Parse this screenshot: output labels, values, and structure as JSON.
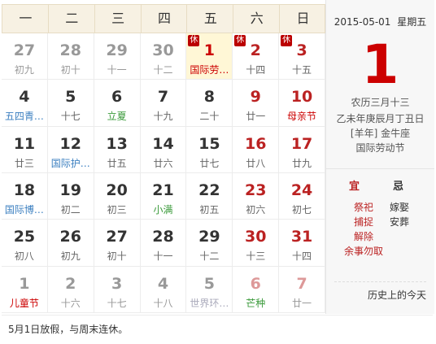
{
  "weekdays": [
    "一",
    "二",
    "三",
    "四",
    "五",
    "六",
    "日"
  ],
  "weeks": [
    [
      {
        "day": "27",
        "lunar": "初九",
        "other": true
      },
      {
        "day": "28",
        "lunar": "初十",
        "other": true
      },
      {
        "day": "29",
        "lunar": "十一",
        "other": true
      },
      {
        "day": "30",
        "lunar": "十二",
        "other": true
      },
      {
        "day": "1",
        "lunar": "国际劳…",
        "badge": "休",
        "selected": true,
        "lunar_style": "festival"
      },
      {
        "day": "2",
        "lunar": "十四",
        "badge": "休",
        "weekend": true
      },
      {
        "day": "3",
        "lunar": "十五",
        "badge": "休",
        "weekend": true
      }
    ],
    [
      {
        "day": "4",
        "lunar": "五四青…",
        "lunar_style": "blue"
      },
      {
        "day": "5",
        "lunar": "十七"
      },
      {
        "day": "6",
        "lunar": "立夏",
        "lunar_style": "green"
      },
      {
        "day": "7",
        "lunar": "十九"
      },
      {
        "day": "8",
        "lunar": "二十"
      },
      {
        "day": "9",
        "lunar": "廿一",
        "weekend": true
      },
      {
        "day": "10",
        "lunar": "母亲节",
        "weekend": true,
        "lunar_style": "red"
      }
    ],
    [
      {
        "day": "11",
        "lunar": "廿三"
      },
      {
        "day": "12",
        "lunar": "国际护…",
        "lunar_style": "blue"
      },
      {
        "day": "13",
        "lunar": "廿五"
      },
      {
        "day": "14",
        "lunar": "廿六"
      },
      {
        "day": "15",
        "lunar": "廿七"
      },
      {
        "day": "16",
        "lunar": "廿八",
        "weekend": true
      },
      {
        "day": "17",
        "lunar": "廿九",
        "weekend": true
      }
    ],
    [
      {
        "day": "18",
        "lunar": "国际博…",
        "lunar_style": "blue"
      },
      {
        "day": "19",
        "lunar": "初二"
      },
      {
        "day": "20",
        "lunar": "初三"
      },
      {
        "day": "21",
        "lunar": "小满",
        "lunar_style": "green"
      },
      {
        "day": "22",
        "lunar": "初五"
      },
      {
        "day": "23",
        "lunar": "初六",
        "weekend": true
      },
      {
        "day": "24",
        "lunar": "初七",
        "weekend": true
      }
    ],
    [
      {
        "day": "25",
        "lunar": "初八"
      },
      {
        "day": "26",
        "lunar": "初九"
      },
      {
        "day": "27",
        "lunar": "初十"
      },
      {
        "day": "28",
        "lunar": "十一"
      },
      {
        "day": "29",
        "lunar": "十二"
      },
      {
        "day": "30",
        "lunar": "十三",
        "weekend": true
      },
      {
        "day": "31",
        "lunar": "十四",
        "weekend": true
      }
    ],
    [
      {
        "day": "1",
        "lunar": "儿童节",
        "other": true,
        "lunar_style": "red"
      },
      {
        "day": "2",
        "lunar": "十六",
        "other": true
      },
      {
        "day": "3",
        "lunar": "十七",
        "other": true
      },
      {
        "day": "4",
        "lunar": "十八",
        "other": true
      },
      {
        "day": "5",
        "lunar": "世界环…",
        "other": true,
        "lunar_style": "gray"
      },
      {
        "day": "6",
        "lunar": "芒种",
        "other": true,
        "weekend": true,
        "lunar_style": "green"
      },
      {
        "day": "7",
        "lunar": "廿一",
        "other": true,
        "weekend": true
      }
    ]
  ],
  "footer_note": "5月1日放假，与周末连休。",
  "panel": {
    "date": "2015-05-01",
    "weekday": "星期五",
    "big_day": "1",
    "lunar_date": "农历三月十三",
    "ganzhi": "乙未年庚辰月丁丑日",
    "zodiac": "[羊年] 金牛座",
    "festival": "国际劳动节",
    "yi_label": "宜",
    "ji_label": "忌",
    "yi": [
      "祭祀",
      "捕捉",
      "解除",
      "余事勿取"
    ],
    "ji": [
      "嫁娶",
      "安葬"
    ],
    "history_link": "历史上的今天"
  },
  "colors": {
    "accent_red": "#cc0000",
    "header_bg": "#f7f1e3",
    "selected_bg": "#fff7d6",
    "panel_bg": "#f7f7f7"
  }
}
